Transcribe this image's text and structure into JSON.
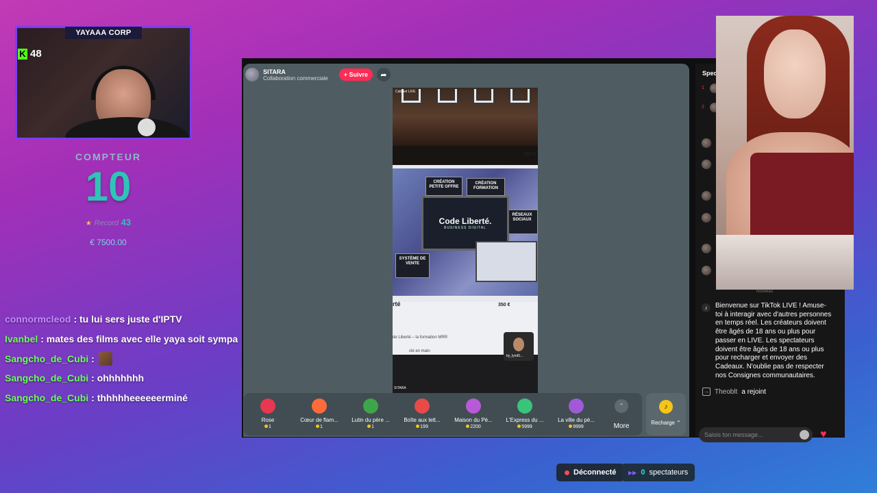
{
  "overlay": {
    "webcam_title": "YAYAAA CORP",
    "kick_count": "48",
    "counter_label": "COMPTEUR",
    "counter_value": "10",
    "record_label": "Record",
    "record_value": "43",
    "money": "€ 7500.00"
  },
  "chat": [
    {
      "user": "connormcleod",
      "color": "#c48bff",
      "msg": ": tu lui sers juste d'IPTV"
    },
    {
      "user": "Ivanbel",
      "color": "#6bff5a",
      "msg": ": mates des films avec elle yaya soit sympa"
    },
    {
      "user": "Sangcho_de_Cubi",
      "color": "#6bff5a",
      "msg": ":"
    },
    {
      "user": "Sangcho_de_Cubi",
      "color": "#6bff5a",
      "msg": ": ohhhhhhh"
    },
    {
      "user": "Sangcho_de_Cubi",
      "color": "#6bff5a",
      "msg": ": thhhhheeeeeerminé"
    }
  ],
  "live": {
    "host_name": "SITARA",
    "host_sub": "Collaboration commerciale",
    "follow_label": "+ Suivre",
    "side_title": "Spec"
  },
  "video": {
    "top_label": "Cabinet LIVE",
    "price1": "350 €",
    "card1": "CRÉATION PETITE OFFRE",
    "card2": "CRÉATION FORMATION",
    "card3": "RÉSEAUX SOCIAUX",
    "card4": "SYSTÈME DE VENTE",
    "laptop_title": "Code Liberté.",
    "laptop_sub": "BUSINESS DIGITAL",
    "bottom_title": "rté",
    "price2": "350 €",
    "line1": "de Liberté – la formation MRR",
    "line2": "clé en main",
    "pip_label": "by_lynd5...",
    "footer_label": "SITARA"
  },
  "gifts": [
    {
      "name": "Rose",
      "price": "1",
      "color": "#e8384f"
    },
    {
      "name": "Cœur de flam...",
      "price": "1",
      "color": "#ff6a3a"
    },
    {
      "name": "Lutin du père ...",
      "price": "1",
      "color": "#3fa54a"
    },
    {
      "name": "Boîte aux lett...",
      "price": "199",
      "color": "#e84a4a"
    },
    {
      "name": "Maison du Pè...",
      "price": "2200",
      "color": "#b85ad8"
    },
    {
      "name": "L'Express du ...",
      "price": "5999",
      "color": "#3ac47a"
    },
    {
      "name": "La ville du pè...",
      "price": "9999",
      "color": "#a05ad8"
    }
  ],
  "more_label": "More",
  "recharge_label": "Recharge ⌃",
  "side": {
    "ranks": [
      "1",
      "2"
    ],
    "sys_msg": "Bienvenue sur TikTok LIVE ! Amuse-toi à interagir avec d'autres personnes en temps réel. Les créateurs doivent être âgés de 18 ans ou plus pour passer en LIVE. Les spectateurs doivent être âgés de 18 ans ou plus pour recharger et envoyer des Cadeaux. N'oublie pas de respecter nos Consignes communautaires.",
    "join_name": "Theoblt",
    "join_text": "a rejoint",
    "input_placeholder": "Saisis ton message..."
  },
  "cam2_label": "Nouveau",
  "status": {
    "disconnected": "Déconnecté",
    "viewers_count": "0",
    "viewers_label": "spectateurs"
  }
}
